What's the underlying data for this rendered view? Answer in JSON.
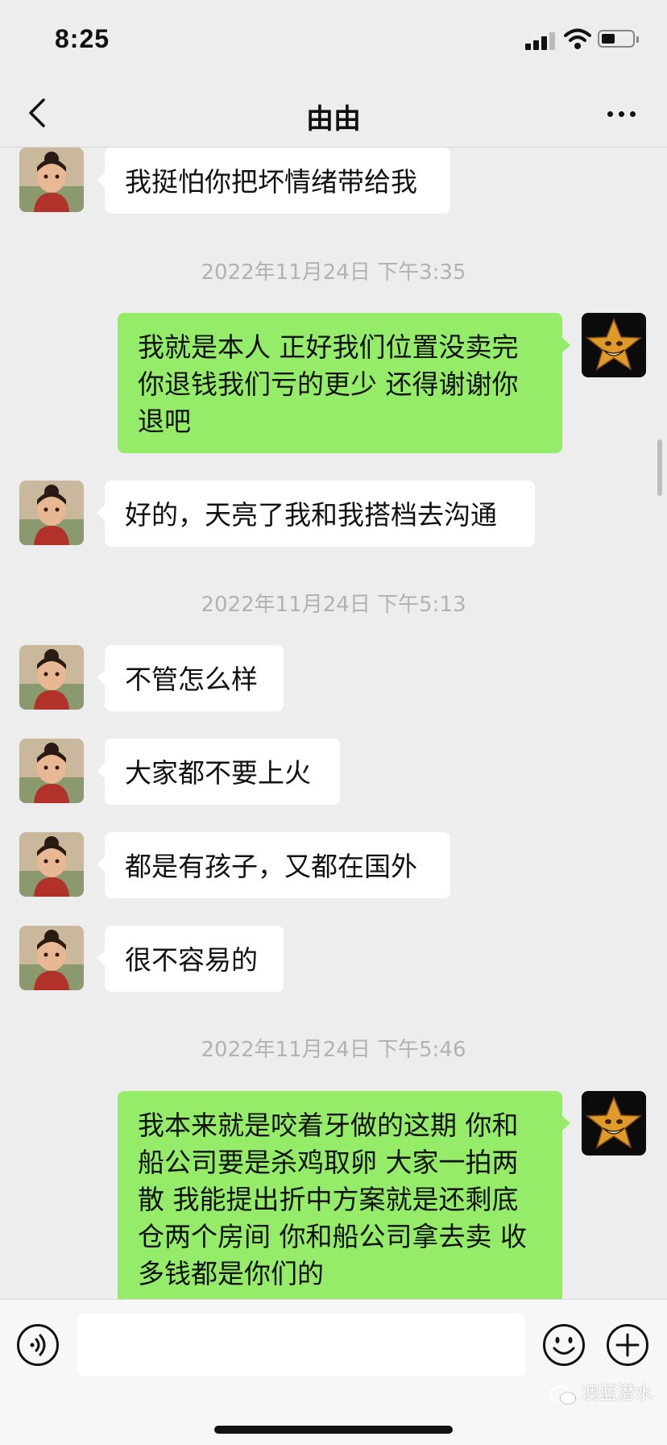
{
  "status_bar": {
    "time": "8:25"
  },
  "nav": {
    "title": "由由"
  },
  "messages": [
    {
      "kind": "in",
      "text": "我挺怕你把坏情绪带给我"
    },
    {
      "kind": "time",
      "text": "2022年11月24日 下午3:35"
    },
    {
      "kind": "out",
      "lines": [
        "我就是本人 正好我们位置没卖完",
        "你退钱我们亏的更少 还得谢谢你",
        "退吧"
      ]
    },
    {
      "kind": "in",
      "text": "好的，天亮了我和我搭档去沟通"
    },
    {
      "kind": "time",
      "text": "2022年11月24日 下午5:13"
    },
    {
      "kind": "in",
      "text": "不管怎么样"
    },
    {
      "kind": "in",
      "text": "大家都不要上火"
    },
    {
      "kind": "in",
      "text": "都是有孩子，又都在国外"
    },
    {
      "kind": "in",
      "text": "很不容易的"
    },
    {
      "kind": "time",
      "text": "2022年11月24日 下午5:46"
    },
    {
      "kind": "out",
      "lines": [
        "我本来就是咬着牙做的这期 你和",
        "船公司要是杀鸡取卵 大家一拍两",
        "散 我能提出折中方案就是还剩底",
        "仓两个房间 你和船公司拿去卖 收",
        "多钱都是你们的"
      ]
    }
  ],
  "input_bar": {
    "text_value": "",
    "watermark": "澳蓝潜水"
  },
  "colors": {
    "background": "#ededed",
    "out_bubble": "#95ec69",
    "in_bubble": "#ffffff",
    "timestamp": "#b2b2b2"
  },
  "icons": {
    "back": "chevron-left-icon",
    "more": "more-dots-icon",
    "voice": "voice-icon",
    "emoji": "emoji-icon",
    "plus": "plus-circle-icon"
  }
}
